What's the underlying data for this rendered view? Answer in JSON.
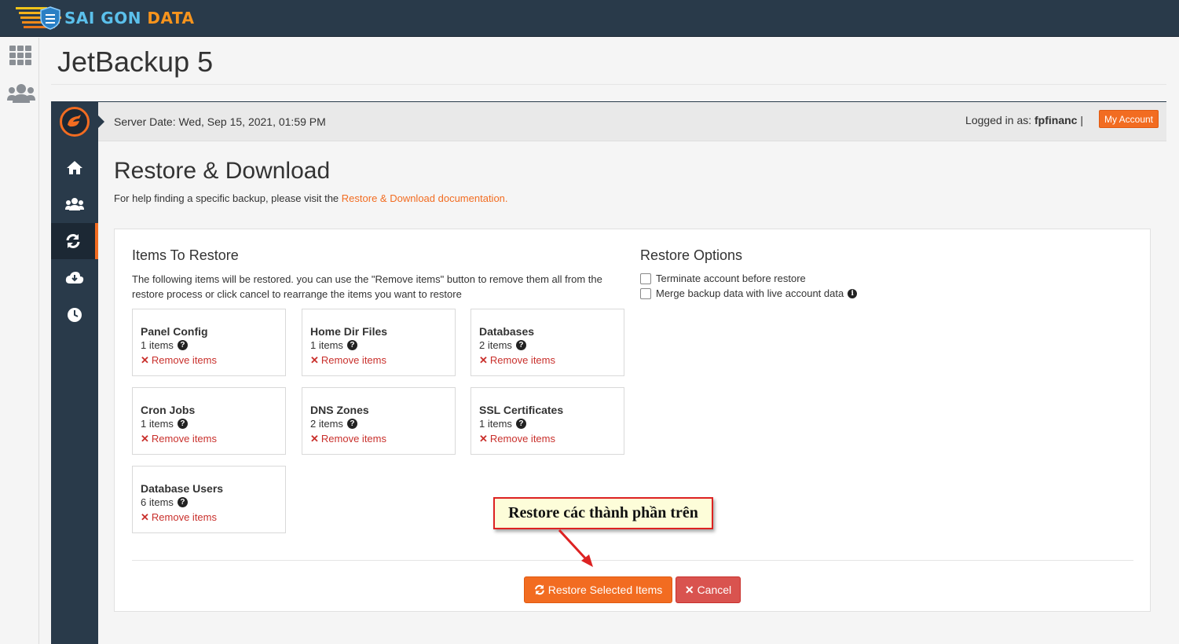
{
  "brand": {
    "part1": "SAI GON",
    "part2": "DATA"
  },
  "page": {
    "title": "JetBackup 5"
  },
  "leftrail": {
    "icons": [
      "grid-icon",
      "users-icon"
    ]
  },
  "jetbackup": {
    "nav_icons": [
      "home-icon",
      "accounts-icon",
      "restore-icon",
      "download-icon",
      "clock-icon"
    ],
    "active_nav": "restore-icon",
    "header": {
      "server_date": "Server Date: Wed, Sep 15, 2021, 01:59 PM",
      "logged_prefix": "Logged in as:",
      "user": "fpfinanc",
      "separator": "|",
      "my_account": "My Account"
    },
    "section_title": "Restore & Download",
    "help_text": "For help finding a specific backup, please visit the ",
    "help_link": "Restore & Download documentation."
  },
  "items_to_restore": {
    "title": "Items To Restore",
    "description": "The following items will be restored. you can use the \"Remove items\" button to remove them all from the restore process or click cancel to rearrange the items you want to restore",
    "remove_label": "Remove items",
    "cards": [
      {
        "name": "Panel Config",
        "count": "1 items"
      },
      {
        "name": "Home Dir Files",
        "count": "1 items"
      },
      {
        "name": "Databases",
        "count": "2 items"
      },
      {
        "name": "Cron Jobs",
        "count": "1 items"
      },
      {
        "name": "DNS Zones",
        "count": "2 items"
      },
      {
        "name": "SSL Certificates",
        "count": "1 items"
      },
      {
        "name": "Database Users",
        "count": "6 items"
      }
    ]
  },
  "restore_options": {
    "title": "Restore Options",
    "options": [
      {
        "label": "Terminate account before restore",
        "checked": false
      },
      {
        "label": "Merge backup data with live account data",
        "checked": false
      }
    ]
  },
  "actions": {
    "restore": "Restore Selected Items",
    "cancel": "Cancel"
  },
  "annotation": {
    "text": "Restore các thành phần trên"
  },
  "colors": {
    "accent": "#f26c21",
    "dark": "#293a4a",
    "danger": "#d9534f"
  }
}
